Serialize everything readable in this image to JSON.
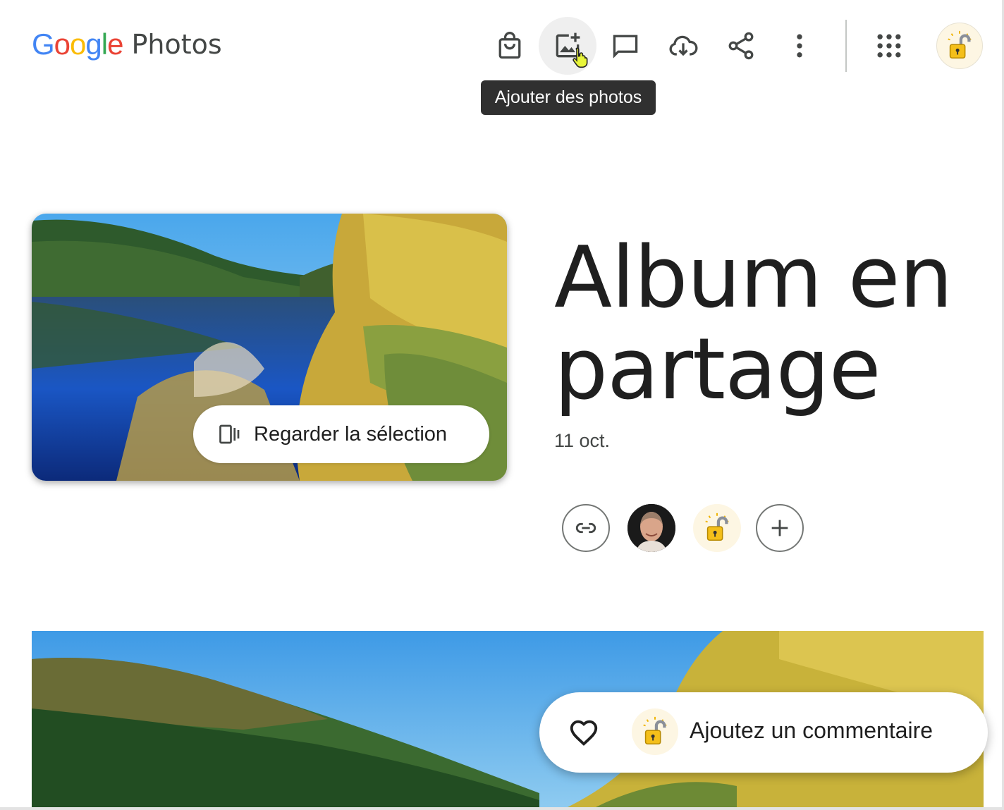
{
  "header": {
    "logo_google": "Google",
    "logo_product": "Photos",
    "tooltip": "Ajouter des photos",
    "toolbar_icons": [
      "shopping-bag-icon",
      "add-photo-icon",
      "comment-icon",
      "cloud-download-icon",
      "share-icon",
      "more-vert-icon",
      "apps-grid-icon"
    ]
  },
  "album": {
    "title_line1": "Album en",
    "title_line2": "partage",
    "date": "11 oct.",
    "watch_label": "Regarder la sélection"
  },
  "comment_bar": {
    "placeholder": "Ajoutez un commentaire"
  },
  "colors": {
    "google_blue": "#4285F4",
    "google_red": "#EA4335",
    "google_yellow": "#FBBC05",
    "google_green": "#34A853",
    "tooltip_bg": "#303030",
    "cursor_yellow": "#e8f53a"
  }
}
